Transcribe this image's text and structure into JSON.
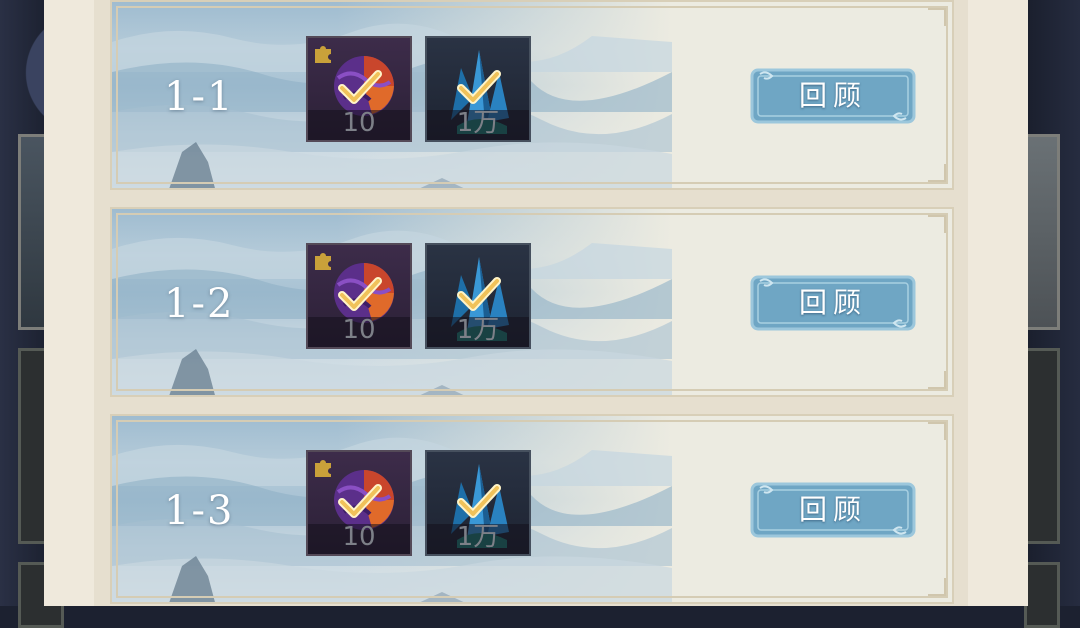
{
  "stages": [
    {
      "label": "1-1",
      "rewards": [
        {
          "icon": "puzzle-fragment-icon",
          "qty": "10",
          "claimed": true
        },
        {
          "icon": "blue-crystal-icon",
          "qty": "1万",
          "claimed": true
        }
      ],
      "review_label": "回顾"
    },
    {
      "label": "1-2",
      "rewards": [
        {
          "icon": "puzzle-fragment-icon",
          "qty": "10",
          "claimed": true
        },
        {
          "icon": "blue-crystal-icon",
          "qty": "1万",
          "claimed": true
        }
      ],
      "review_label": "回顾"
    },
    {
      "label": "1-3",
      "rewards": [
        {
          "icon": "puzzle-fragment-icon",
          "qty": "10",
          "claimed": true
        },
        {
          "icon": "blue-crystal-icon",
          "qty": "1万",
          "claimed": true
        }
      ],
      "review_label": "回顾"
    }
  ],
  "colors": {
    "panel": "#efe9dc",
    "button": "#6fa6c4",
    "check": "#f3d27a"
  }
}
